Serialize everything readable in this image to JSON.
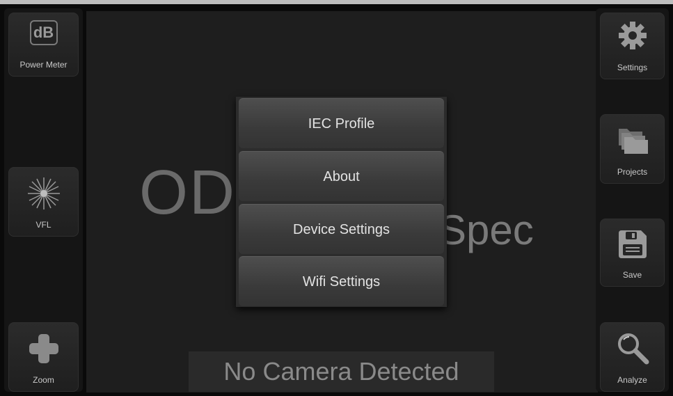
{
  "left_sidebar": {
    "power_meter": {
      "label": "Power Meter",
      "icon_text": "dB",
      "icon": "db-icon"
    },
    "vfl": {
      "label": "VFL",
      "icon": "laser-burst-icon"
    },
    "zoom": {
      "label": "Zoom",
      "icon": "plus-icon"
    }
  },
  "right_sidebar": {
    "settings": {
      "label": "Settings",
      "icon": "gear-icon"
    },
    "projects": {
      "label": "Projects",
      "icon": "folders-icon"
    },
    "save": {
      "label": "Save",
      "icon": "floppy-disk-icon"
    },
    "analyze": {
      "label": "Analyze",
      "icon": "magnifier-icon"
    }
  },
  "main": {
    "background_title_left": "OD",
    "background_title_right": "Spec",
    "status": "No Camera Detected"
  },
  "settings_menu": {
    "items": [
      "IEC Profile",
      "About",
      "Device Settings",
      "Wifi Settings"
    ]
  }
}
